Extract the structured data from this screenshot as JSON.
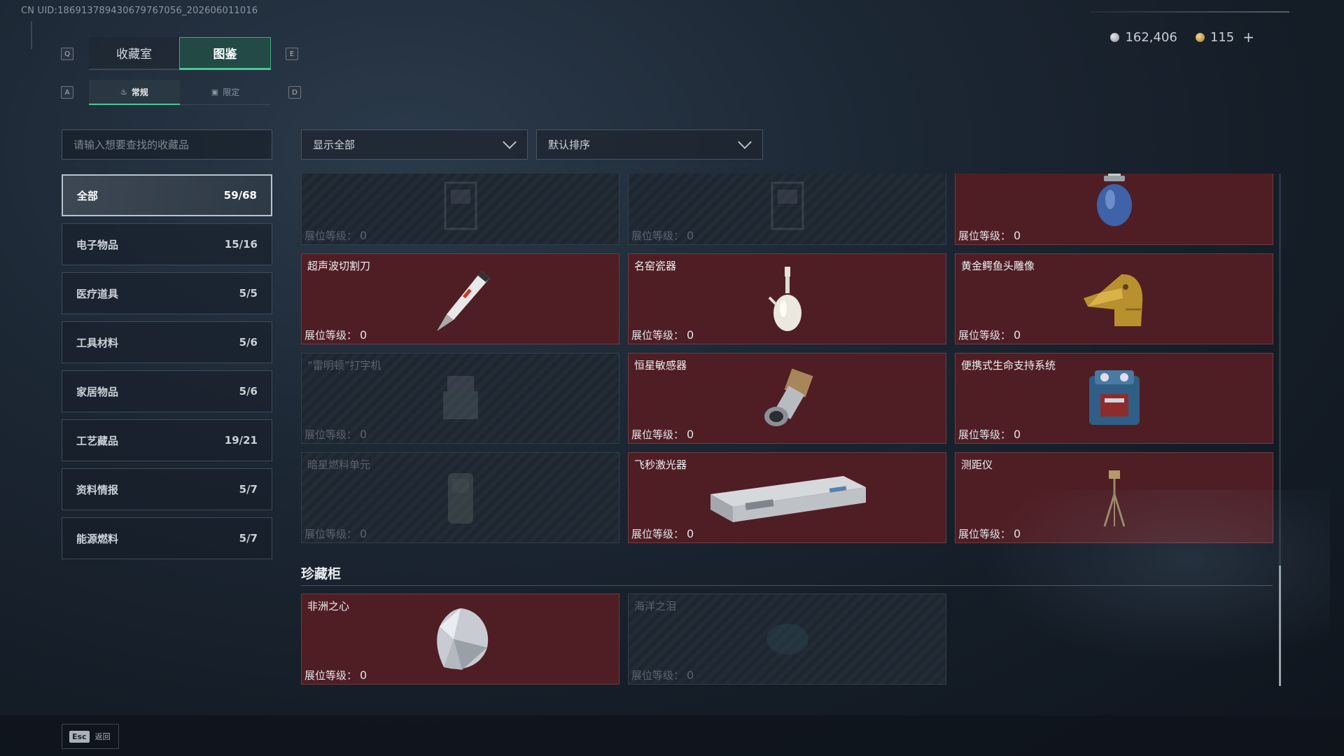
{
  "header": {
    "uid": "CN UID:186913789430679767056_202606011016"
  },
  "currency": {
    "silver": "162,406",
    "gold": "115",
    "add_icon": "plus-icon"
  },
  "keycaps": {
    "q": "Q",
    "e": "E",
    "a": "A",
    "d": "D"
  },
  "tabs": [
    {
      "label": "收藏室",
      "active": false
    },
    {
      "label": "图鉴",
      "active": true
    }
  ],
  "subtabs": [
    {
      "label": "常规",
      "icon": "flame-icon",
      "active": true
    },
    {
      "label": "限定",
      "icon": "image-icon",
      "active": false
    }
  ],
  "search": {
    "placeholder": "请输入想要查找的收藏品"
  },
  "categories": [
    {
      "label": "全部",
      "count": "59/68",
      "active": true
    },
    {
      "label": "电子物品",
      "count": "15/16"
    },
    {
      "label": "医疗道具",
      "count": "5/5"
    },
    {
      "label": "工具材料",
      "count": "5/6"
    },
    {
      "label": "家居物品",
      "count": "5/6"
    },
    {
      "label": "工艺藏品",
      "count": "19/21"
    },
    {
      "label": "资料情报",
      "count": "5/7"
    },
    {
      "label": "能源燃料",
      "count": "5/7"
    }
  ],
  "filters": {
    "show": "显示全部",
    "sort": "默认排序"
  },
  "level_label": "展位等级：",
  "cards": [
    {
      "name": "",
      "level": "0",
      "locked": true,
      "icon": "cabinet-icon"
    },
    {
      "name": "",
      "level": "0",
      "locked": true,
      "icon": "cabinet-icon"
    },
    {
      "name": "",
      "level": "0",
      "locked": false,
      "icon": "gas-canister-icon"
    },
    {
      "name": "超声波切割刀",
      "level": "0",
      "locked": false,
      "icon": "ultrasonic-knife-icon"
    },
    {
      "name": "名窑瓷器",
      "level": "0",
      "locked": false,
      "icon": "porcelain-vase-icon"
    },
    {
      "name": "黄金鳄鱼头雕像",
      "level": "0",
      "locked": false,
      "icon": "gold-crocodile-head-icon"
    },
    {
      "name": "“雷明顿”打字机",
      "level": "0",
      "locked": true,
      "icon": "typewriter-icon"
    },
    {
      "name": "恒星敏感器",
      "level": "0",
      "locked": false,
      "icon": "star-sensor-icon"
    },
    {
      "name": "便携式生命支持系统",
      "level": "0",
      "locked": false,
      "icon": "life-support-icon"
    },
    {
      "name": "暗星燃料单元",
      "level": "0",
      "locked": true,
      "icon": "fuel-cell-icon"
    },
    {
      "name": "飞秒激光器",
      "level": "0",
      "locked": false,
      "icon": "laser-device-icon"
    },
    {
      "name": "测距仪",
      "level": "0",
      "locked": false,
      "icon": "rangefinder-tripod-icon"
    }
  ],
  "treasure_section": {
    "title": "珍藏柜",
    "cards": [
      {
        "name": "非洲之心",
        "level": "0",
        "locked": false,
        "icon": "diamond-icon"
      },
      {
        "name": "海洋之泪",
        "level": "0",
        "locked": true,
        "icon": "gem-icon"
      }
    ]
  },
  "footer": {
    "esc_key": "Esc",
    "back_label": "返回"
  }
}
